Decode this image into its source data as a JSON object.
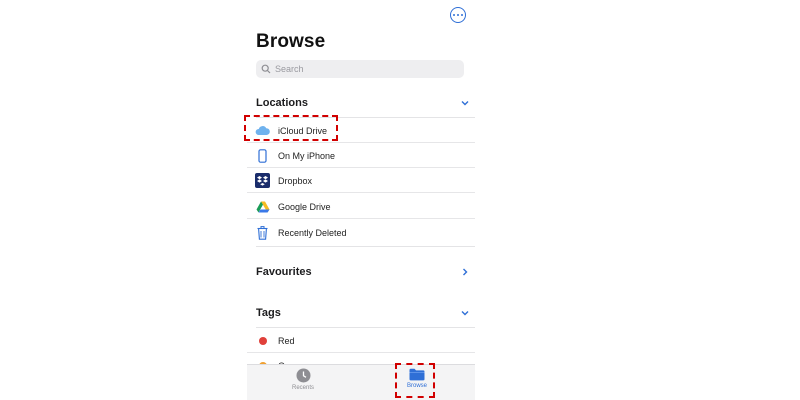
{
  "header": {
    "title": "Browse"
  },
  "search": {
    "placeholder": "Search"
  },
  "sections": {
    "locations": {
      "label": "Locations",
      "items": [
        {
          "label": "iCloud Drive",
          "icon": "cloud-icon"
        },
        {
          "label": "On My iPhone",
          "icon": "phone-icon"
        },
        {
          "label": "Dropbox",
          "icon": "dropbox-icon"
        },
        {
          "label": "Google Drive",
          "icon": "google-drive-icon"
        },
        {
          "label": "Recently Deleted",
          "icon": "trash-icon"
        }
      ]
    },
    "favourites": {
      "label": "Favourites"
    },
    "tags": {
      "label": "Tags",
      "items": [
        {
          "label": "Red",
          "color": "#e0403a"
        },
        {
          "label": "Orange",
          "color": "#f0a030"
        }
      ]
    }
  },
  "tabbar": {
    "tabs": [
      {
        "label": "Recents",
        "icon": "clock-icon",
        "active": false
      },
      {
        "label": "Browse",
        "icon": "folder-icon",
        "active": true
      }
    ]
  },
  "colors": {
    "accent": "#2f6fd6",
    "highlight": "#d10000",
    "inactive_tab": "#8e8e93"
  }
}
